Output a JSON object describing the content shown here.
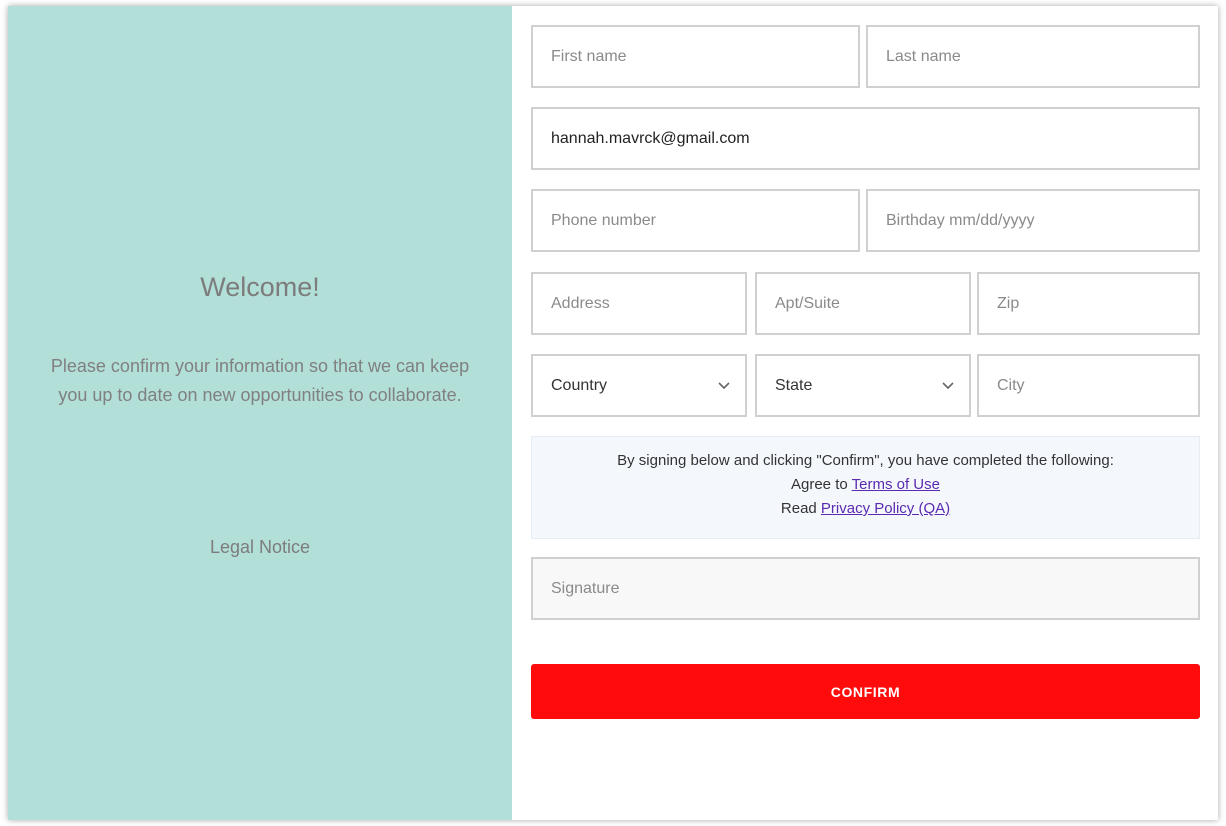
{
  "left_panel": {
    "title": "Welcome!",
    "message": "Please confirm your information so that we can keep you up to date on new opportunities to collaborate.",
    "legal_link": "Legal Notice",
    "background_color": "#b3dfd9"
  },
  "form": {
    "first_name": {
      "placeholder": "First name",
      "value": ""
    },
    "last_name": {
      "placeholder": "Last name",
      "value": ""
    },
    "email": {
      "placeholder": "",
      "value": "hannah.mavrck@gmail.com"
    },
    "phone": {
      "placeholder": "Phone number",
      "value": ""
    },
    "birthday": {
      "placeholder": "Birthday mm/dd/yyyy",
      "value": ""
    },
    "address": {
      "placeholder": "Address",
      "value": ""
    },
    "apt": {
      "placeholder": "Apt/Suite",
      "value": ""
    },
    "zip": {
      "placeholder": "Zip",
      "value": ""
    },
    "country": {
      "selected": "Country",
      "icon": "chevron-down-icon"
    },
    "state": {
      "selected": "State",
      "icon": "chevron-down-icon"
    },
    "city": {
      "placeholder": "City",
      "value": ""
    },
    "signature": {
      "placeholder": "Signature",
      "value": ""
    }
  },
  "notice": {
    "intro": "By signing below and clicking \"Confirm\", you have completed the following:",
    "agree_prefix": "Agree to",
    "terms_link": "Terms of Use",
    "read_prefix": "Read",
    "privacy_link": "Privacy Policy (QA)",
    "link_color": "#5a2ab0"
  },
  "confirm_button": {
    "label": "CONFIRM",
    "color": "#ff0b0b"
  }
}
